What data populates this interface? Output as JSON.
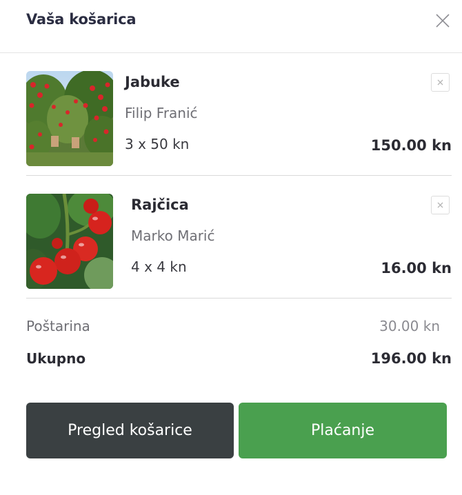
{
  "header": {
    "title": "Vaša košarica"
  },
  "items": [
    {
      "name": "Jabuke",
      "seller": "Filip Franić",
      "quantity_price": "3 x 50 kn",
      "total": "150.00 kn",
      "image_icon": "apple-orchard-photo"
    },
    {
      "name": "Rajčica",
      "seller": "Marko Marić",
      "quantity_price": "4 x 4 kn",
      "total": "16.00 kn",
      "image_icon": "tomato-plant-photo"
    }
  ],
  "summary": {
    "shipping_label": "Poštarina",
    "shipping_amount": "30.00 kn",
    "total_label": "Ukupno",
    "total_amount": "196.00 kn"
  },
  "buttons": {
    "review_label": "Pregled košarice",
    "checkout_label": "Plaćanje"
  },
  "colors": {
    "checkout_button": "#4aa04f",
    "review_button": "#3a4042",
    "title_text": "#2b2d42"
  }
}
